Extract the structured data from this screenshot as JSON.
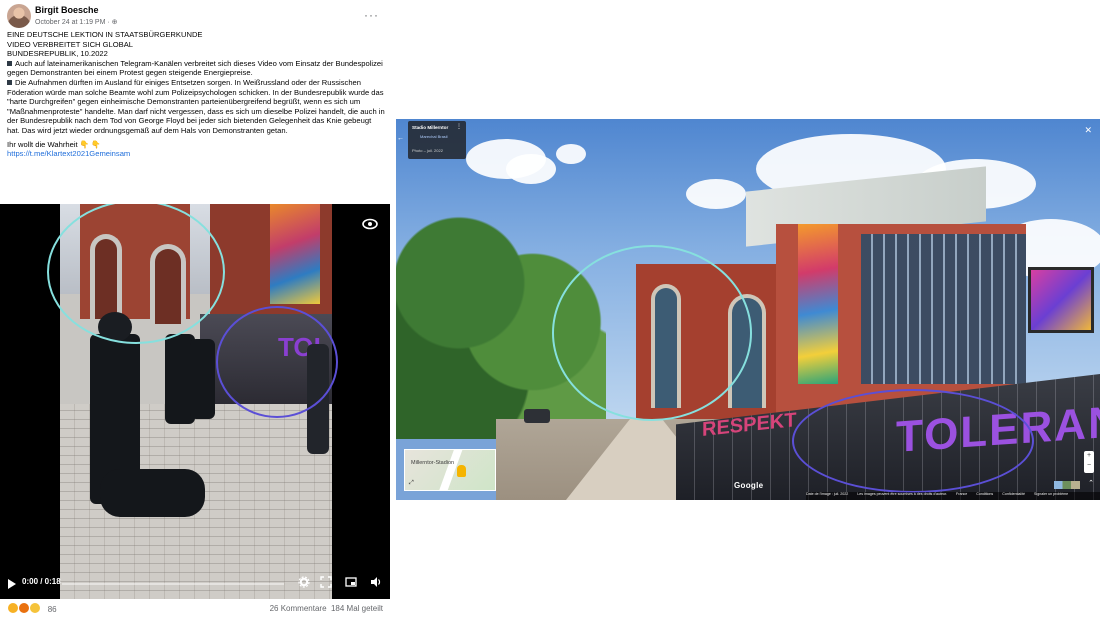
{
  "post": {
    "author": "Birgit Boesche",
    "timestamp": "October 24 at 1:19 PM",
    "audience_icon": "globe-icon",
    "more_label": "···",
    "lines": [
      "EINE DEUTSCHE LEKTION IN STAATSBÜRGERKUNDE",
      "VIDEO VERBREITET SICH GLOBAL",
      "BUNDESREPUBLIK, 10.2022"
    ],
    "para1": "Auch auf lateinamerikanischen Telegram-Kanälen verbreitet sich dieses Video vom Einsatz der Bundespolizei gegen Demonstranten bei einem Protest gegen steigende Energiepreise.",
    "para2": "Die Aufnahmen dürften im Ausland für einiges Entsetzen sorgen. In Weißrussland oder der Russischen Föderation würde man solche Beamte wohl zum Polizeipsychologen schicken. In der Bundesrepublik wurde das \"harte Durchgreifen\" gegen einheimische Demonstranten parteienübergreifend begrüßt, wenn es sich um \"Maßnahmenproteste\" handelte. Man darf nicht vergessen, dass es sich um dieselbe Polizei handelt, die auch in der Bundesrepublik nach dem Tod von George Floyd bei jeder sich bietenden Gelegenheit das Knie gebeugt hat. Das wird jetzt wieder ordnungsgemäß auf dem Hals von Demonstranten getan.",
    "closing": "Ihr wollt die Wahrheit",
    "closing_emoji": "👇 👇",
    "link": "https://t.me/Klartext2021Gemeinsam"
  },
  "video": {
    "time": "0:00 / 0:18",
    "wall_text": "TOL"
  },
  "footer": {
    "reaction_count": "86",
    "comments": "26 Kommentare",
    "shares": "184 Mal geteilt"
  },
  "streetview": {
    "place_title": "Stadio Millerntor",
    "place_sub": "Marechal Brasil",
    "photo_date": "Photo – juil. 2022",
    "minimap_label": "Millerntor-Stadion",
    "google": "Google",
    "bottombar": [
      "Date de l'image : juil. 2022",
      "Les images peuvent être soumises à des droits d'auteur.",
      "France",
      "Conditions",
      "Confidentialité",
      "Signaler un problème"
    ],
    "mural_text_right": "TOLERANT",
    "mural_text_left": "RESPEKT"
  },
  "colors": {
    "ellipse_cyan": "#86e0de",
    "ellipse_blue": "#5b4fd6",
    "link": "#216fdb"
  }
}
